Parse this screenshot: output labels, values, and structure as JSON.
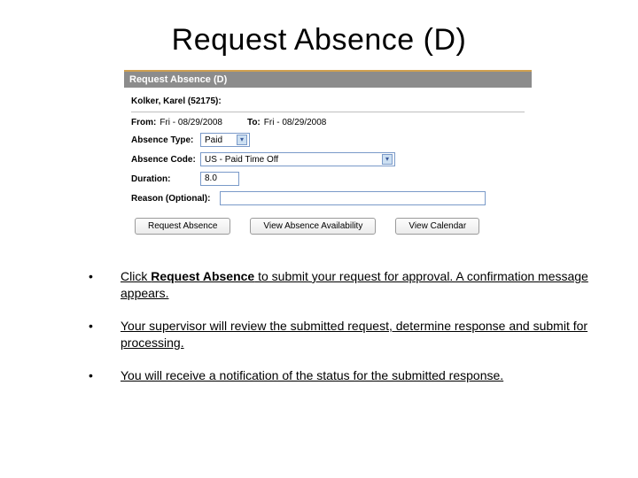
{
  "title": "Request Absence (D)",
  "panel": {
    "header": "Request Absence (D)",
    "employee": "Kolker, Karel (52175):",
    "from_label": "From:",
    "from_value": "Fri - 08/29/2008",
    "to_label": "To:",
    "to_value": "Fri - 08/29/2008",
    "absence_type_label": "Absence Type:",
    "absence_type_value": "Paid",
    "absence_code_label": "Absence Code:",
    "absence_code_value": "US - Paid Time Off",
    "duration_label": "Duration:",
    "duration_value": "8.0",
    "reason_label": "Reason (Optional):",
    "reason_value": "",
    "btn_request": "Request Absence",
    "btn_view_avail": "View Absence Availability",
    "btn_view_cal": "View Calendar"
  },
  "bullets": {
    "b1_pre": "Click ",
    "b1_strong": "Request Absence",
    "b1_post": " to submit your request for approval. A confirmation message appears.",
    "b2": "Your supervisor will review the submitted request, determine response and submit for processing.",
    "b3": "You will receive a notification of the status for the submitted response."
  }
}
